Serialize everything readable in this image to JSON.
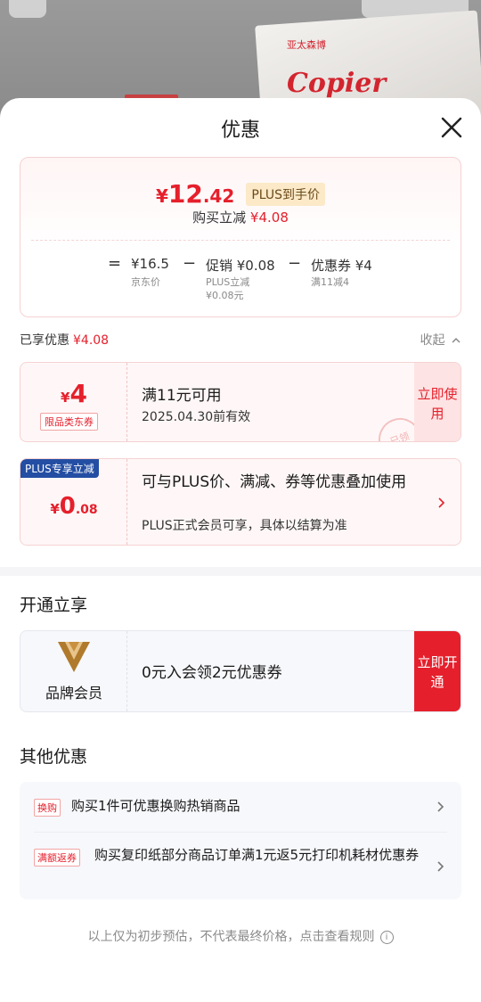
{
  "background": {
    "product_brand": "Copier",
    "product_logo": "亚太森博"
  },
  "sheet": {
    "title": "优惠"
  },
  "summary": {
    "price_symbol": "¥",
    "price_int": "12",
    "price_dec": ".42",
    "price_tag": "PLUS到手价",
    "buy_label": "购买立减",
    "buy_value": "¥4.08",
    "eq": "=",
    "jd_price": "¥16.5",
    "jd_label": "京东价",
    "minus1": "−",
    "promo": "促销 ¥0.08",
    "promo_sub1": "PLUS立减",
    "promo_sub2": "¥0.08元",
    "minus2": "−",
    "coupon": "优惠券 ¥4",
    "coupon_sub": "满11减4"
  },
  "enjoyed": {
    "label": "已享优惠",
    "value": "¥4.08",
    "collapse": "收起"
  },
  "coupon1": {
    "symbol": "¥",
    "amount": "4",
    "tag": "限品类东券",
    "title": "满11元可用",
    "subtitle": "2025.04.30前有效",
    "button": "立即使用",
    "stamp": "已领"
  },
  "coupon2": {
    "badge": "PLUS专享立减",
    "symbol": "¥",
    "amount_int": "0",
    "amount_dec": ".08",
    "title": "可与PLUS价、满减、券等优惠叠加使用",
    "subtitle": "PLUS正式会员可享，具体以结算为准"
  },
  "open_section": {
    "title": "开通立享",
    "member_name": "品牌会员",
    "member_text": "0元入会领2元优惠券",
    "button": "立即开通"
  },
  "other_section": {
    "title": "其他优惠",
    "items": [
      {
        "tag": "换购",
        "text": "购买1件可优惠换购热销商品"
      },
      {
        "tag": "满额返券",
        "text": "购买复印纸部分商品订单满1元返5元打印机耗材优惠券"
      }
    ]
  },
  "footer": {
    "text": "以上仅为初步预估，不代表最终价格，点击查看规则",
    "icon": "i"
  }
}
